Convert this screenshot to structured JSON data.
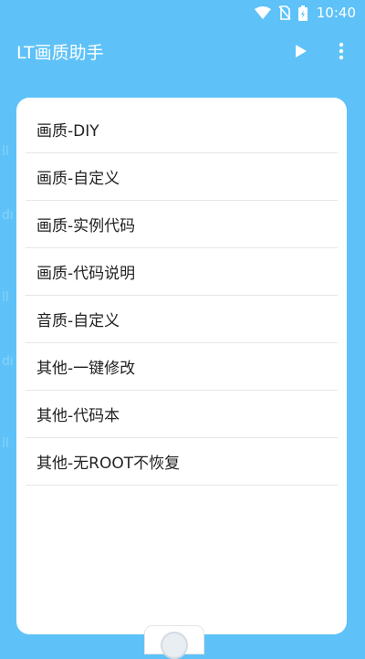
{
  "status_bar": {
    "time": "10:40",
    "icons": [
      "wifi-icon",
      "no-sim-icon",
      "battery-charging-icon"
    ]
  },
  "app_bar": {
    "title": "LT画质助手",
    "actions": [
      "play-icon",
      "more-vert-icon"
    ]
  },
  "menu": {
    "items": [
      {
        "label": "画质-DIY"
      },
      {
        "label": "画质-自定义"
      },
      {
        "label": "画质-实例代码"
      },
      {
        "label": "画质-代码说明"
      },
      {
        "label": "音质-自定义"
      },
      {
        "label": "其他-一键修改"
      },
      {
        "label": "其他-代码本"
      },
      {
        "label": "其他-无ROOT不恢复"
      }
    ]
  },
  "colors": {
    "background": "#5ec2f8",
    "card": "#ffffff",
    "text": "#222222",
    "divider": "#e6e6e6"
  }
}
